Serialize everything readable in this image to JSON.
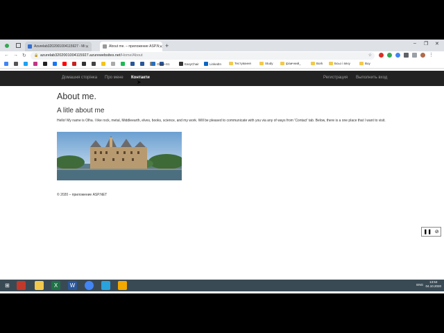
{
  "browser": {
    "tabs": [
      {
        "title": "Azurelab3202001004115927 - Mi",
        "active": false,
        "icon_color": "#2f6fd6"
      },
      {
        "title": "About me. – приложение ASP.N",
        "active": true,
        "icon_color": "#888888"
      }
    ],
    "address": {
      "host": "azurelab3202001004115927.azurewebsites.net",
      "path": "/Home/About"
    },
    "bookmarks": [
      {
        "label": "Oltwe-S1",
        "type": "site",
        "color": "#2a6ebb"
      },
      {
        "label": "EasyChair",
        "type": "site",
        "color": "#333333"
      },
      {
        "label": "LinkedIn",
        "type": "site",
        "color": "#0a66c2"
      },
      {
        "label": "Тестування",
        "type": "folder"
      },
      {
        "label": "Study",
        "type": "folder"
      },
      {
        "label": "фізичний_",
        "type": "folder"
      },
      {
        "label": "Вork",
        "type": "folder"
      },
      {
        "label": "Бсьо і вяху",
        "type": "folder"
      },
      {
        "label": "Buy",
        "type": "folder"
      }
    ]
  },
  "site": {
    "nav": {
      "home": "Домашня сторінка",
      "about": "Про мене",
      "contacts": "Контакти",
      "register": "Регистрация",
      "login": "Выполнить вход"
    },
    "page_title": "About me.",
    "subtitle": "A litle about me",
    "paragraph": "Hello! My name is Olha. I like rock, metal, Middleearth, elves, books, science, and my work. Will be pleased to communicate with you via any of ways from 'Contact' tab. Below, there is a one place that I want to visit.",
    "footer": "© 2020 – приложение ASP.NET"
  },
  "taskbar": {
    "time": "13:53",
    "date": "04.10.2020",
    "lang": "ENG"
  }
}
